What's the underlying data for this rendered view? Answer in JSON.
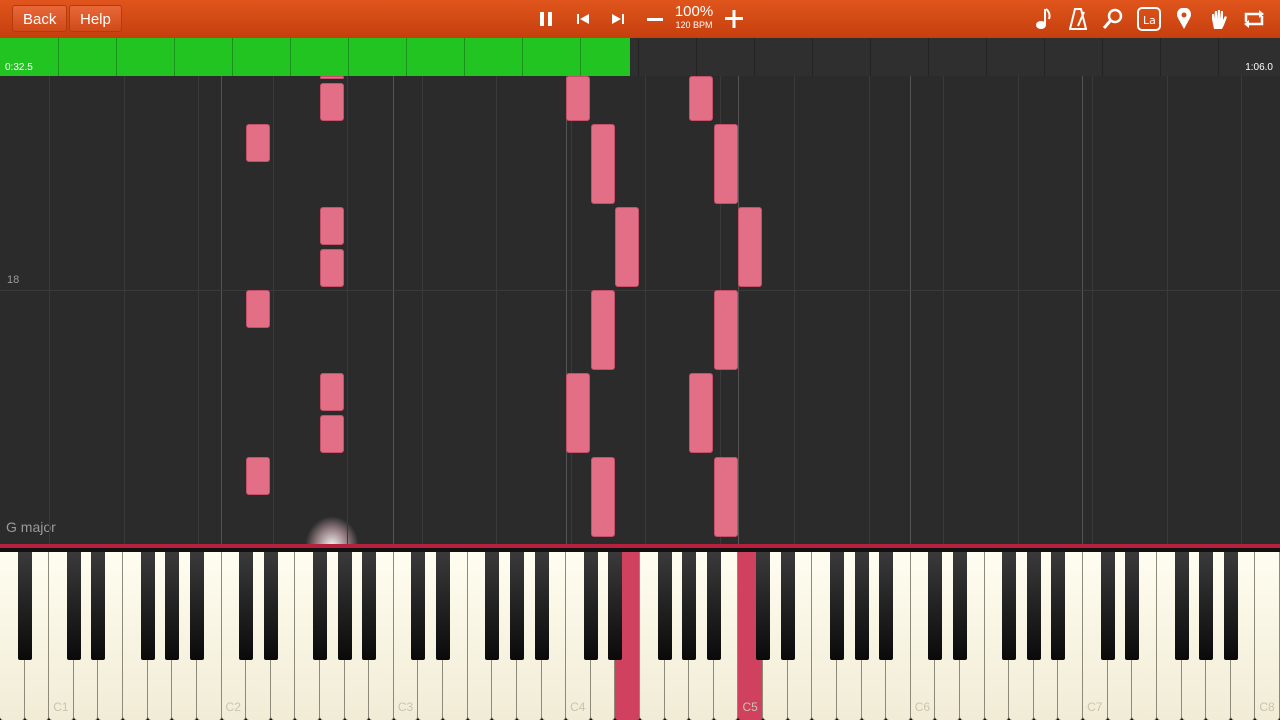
{
  "toolbar": {
    "back_label": "Back",
    "help_label": "Help",
    "speed_percent": "100%",
    "tempo": "120 BPM",
    "icons": [
      "pause-icon",
      "skip-back-icon",
      "skip-forward-icon",
      "minus-icon",
      "plus-icon",
      "music-note-icon",
      "metronome-icon",
      "magnifier-icon",
      "note-label-icon",
      "location-pin-icon",
      "hand-icon",
      "loop-icon"
    ]
  },
  "progress": {
    "current_time": "0:32.5",
    "total_time": "1:06.0",
    "fraction": 0.492,
    "color": "#22c422"
  },
  "roll": {
    "measure_number": "18",
    "key_signature": "G major",
    "note_color": "#e36f86"
  },
  "keyboard": {
    "octave_labels": [
      "C1",
      "C2",
      "C3",
      "C4",
      "C5",
      "C6",
      "C7",
      "C8"
    ],
    "highlight_color": "#d0405f"
  }
}
